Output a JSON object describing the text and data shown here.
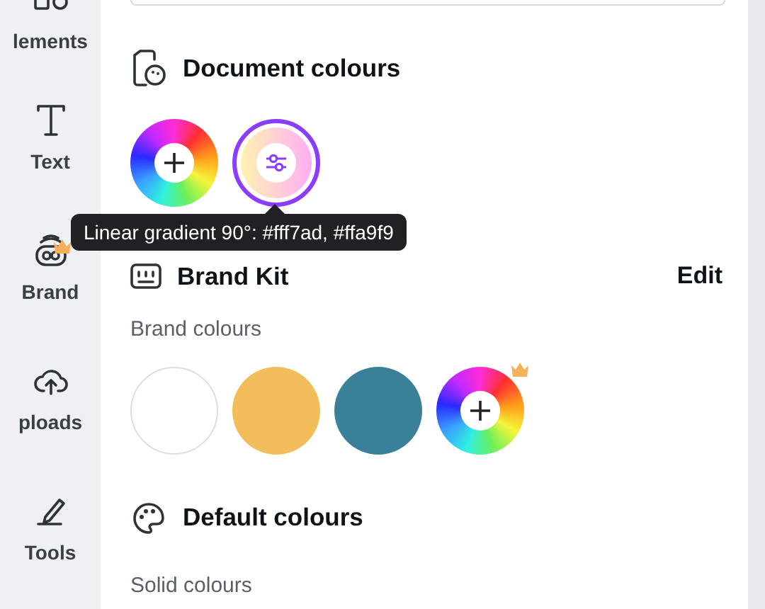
{
  "sidebar": {
    "items": [
      {
        "label": "lements",
        "premium": false
      },
      {
        "label": "Text",
        "premium": false
      },
      {
        "label": "Brand",
        "premium": true
      },
      {
        "label": "ploads",
        "premium": false
      },
      {
        "label": "Tools",
        "premium": false
      }
    ]
  },
  "document_colours": {
    "title": "Document colours",
    "swatches": [
      {
        "kind": "add",
        "selected": false
      },
      {
        "kind": "gradient",
        "selected": true
      }
    ]
  },
  "tooltip": {
    "text": "Linear gradient 90°: #fff7ad, #ffa9f9"
  },
  "brand_kit": {
    "title": "Brand Kit",
    "action": "Edit",
    "subtitle": "Brand colours",
    "swatches": [
      {
        "kind": "solid",
        "color": "#ffffff"
      },
      {
        "kind": "solid",
        "color": "#f2bd5a"
      },
      {
        "kind": "solid",
        "color": "#3b8099"
      },
      {
        "kind": "add",
        "premium": true
      }
    ]
  },
  "default_colours": {
    "title": "Default colours",
    "subtitle": "Solid colours"
  }
}
